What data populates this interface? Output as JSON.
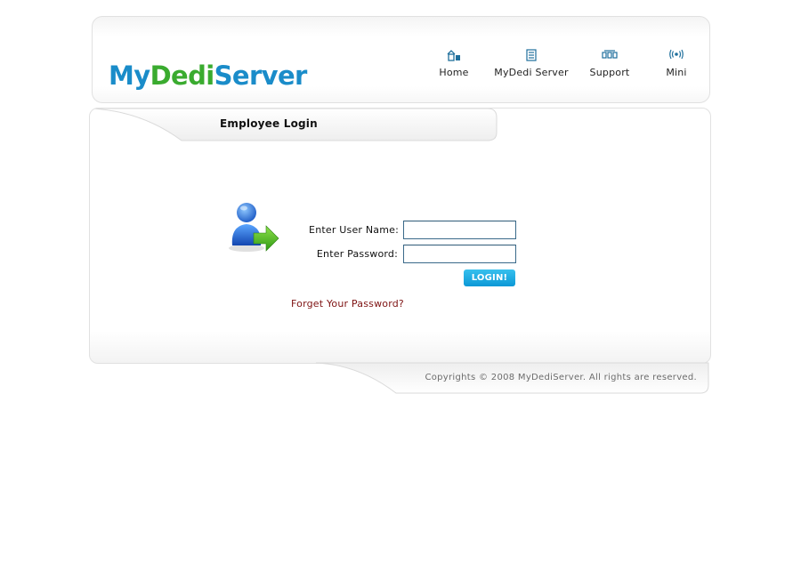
{
  "header": {
    "logo": {
      "part1": "My",
      "part2": "Dedi",
      "part3": "Server"
    },
    "nav": [
      {
        "label": "Home",
        "icon": "home-icon"
      },
      {
        "label": "MyDedi Server",
        "icon": "server-icon"
      },
      {
        "label": "Support",
        "icon": "support-icon"
      },
      {
        "label": "Mini",
        "icon": "wireless-icon"
      }
    ]
  },
  "login": {
    "title": "Employee Login",
    "username_label": "Enter User Name:",
    "username_value": "",
    "password_label": "Enter Password:",
    "password_value": "",
    "login_button": "LOGIN!",
    "forgot_link": "Forget Your Password?"
  },
  "footer": {
    "copyright": "Copyrights © 2008 MyDediServer. All rights are reserved."
  },
  "colors": {
    "logo_blue": "#1a8cc9",
    "logo_green": "#3aab2f",
    "nav_icon": "#1f6f9c",
    "button": "#13a3dd",
    "forgot_link": "#7e1212"
  }
}
